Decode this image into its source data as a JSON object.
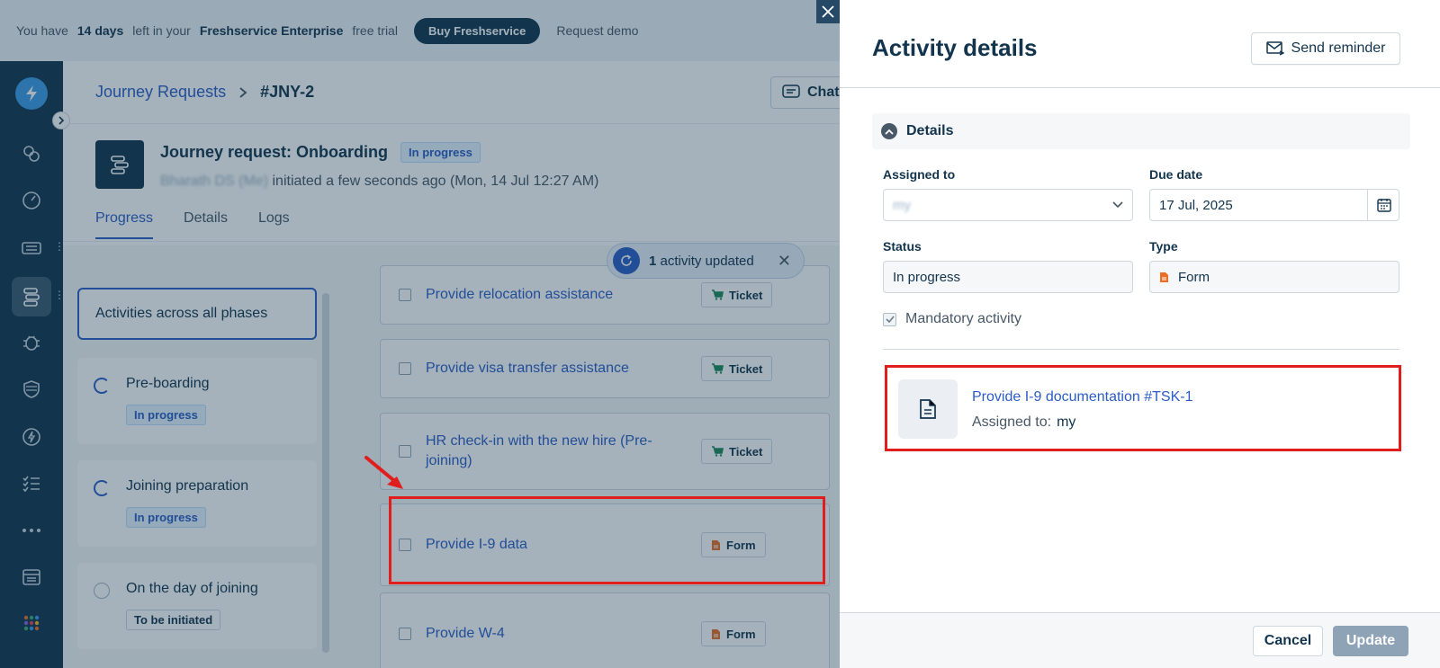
{
  "trial_bar": {
    "prefix": "You have",
    "days": "14 days",
    "middle": "left in your",
    "plan": "Freshservice Enterprise",
    "suffix": "free trial",
    "buy_label": "Buy Freshservice",
    "demo_label": "Request demo"
  },
  "header": {
    "breadcrumb_root": "Journey Requests",
    "breadcrumb_current": "#JNY-2",
    "chat_label": "Chat"
  },
  "request": {
    "title": "Journey request: Onboarding",
    "status": "In progress",
    "initiator": "Bharath DS (Me)",
    "initiated_text": "initiated a few seconds ago (Mon, 14 Jul 12:27 AM)"
  },
  "tabs": [
    "Progress",
    "Details",
    "Logs"
  ],
  "phases": {
    "all_label": "Activities across all phases",
    "items": [
      {
        "name": "Pre-boarding",
        "status": "In progress"
      },
      {
        "name": "Joining preparation",
        "status": "In progress"
      },
      {
        "name": "On the day of joining",
        "status": "To be initiated"
      }
    ]
  },
  "activities": [
    {
      "name": "Provide relocation assistance",
      "type": "Ticket"
    },
    {
      "name": "Provide visa transfer assistance",
      "type": "Ticket"
    },
    {
      "name": "HR check-in with the new hire (Pre-joining)",
      "type": "Ticket"
    },
    {
      "name": "Provide I-9 data",
      "type": "Form"
    },
    {
      "name": "Provide W-4",
      "type": "Form"
    }
  ],
  "toast": {
    "count": "1",
    "text": "activity updated"
  },
  "drawer": {
    "title": "Activity details",
    "send_reminder_label": "Send reminder",
    "section_title": "Details",
    "assigned_to_label": "Assigned to",
    "assigned_to_value": "my",
    "due_date_label": "Due date",
    "due_date_value": "17 Jul, 2025",
    "status_label": "Status",
    "status_value": "In progress",
    "type_label": "Type",
    "type_value": "Form",
    "mandatory_label": "Mandatory activity",
    "task": {
      "link_text": "Provide I-9 documentation #TSK-1",
      "assigned_label": "Assigned to:",
      "assigned_value": "my"
    },
    "cancel_label": "Cancel",
    "update_label": "Update"
  },
  "colors": {
    "nav_bg": "#12344d",
    "link_blue": "#2c5cc5",
    "highlight_red": "#e01e1e",
    "form_orange": "#e86f25",
    "ticket_green": "#1d8a5a"
  }
}
